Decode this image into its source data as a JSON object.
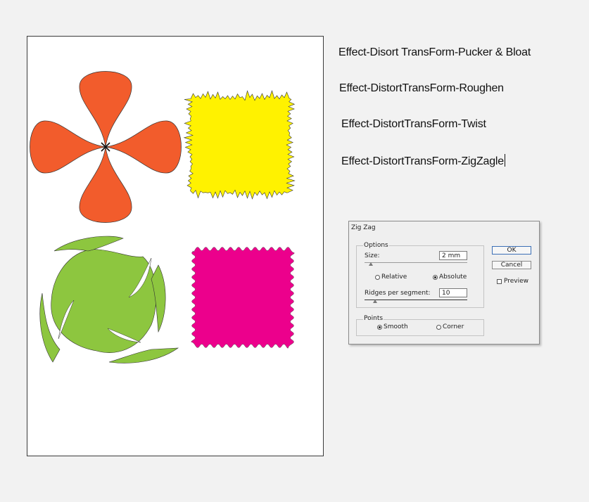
{
  "captions": [
    "Effect-Disort TransForm-Pucker & Bloat",
    "Effect-DistortTransForm-Roughen",
    "Effect-DistortTransForm-Twist",
    "Effect-DistortTransForm-ZigZagle"
  ],
  "shapes": {
    "pucker_color": "#f25c2c",
    "roughen_color": "#fff200",
    "twist_color": "#8dc63f",
    "zigzag_color": "#ec008c"
  },
  "dialog": {
    "title": "Zig Zag",
    "options_label": "Options",
    "size_label": "Size:",
    "size_value": "2 mm",
    "relative_label": "Relative",
    "absolute_label": "Absolute",
    "ridges_label": "Ridges per segment:",
    "ridges_value": "10",
    "points_label": "Points",
    "smooth_label": "Smooth",
    "corner_label": "Corner",
    "ok_label": "OK",
    "cancel_label": "Cancel",
    "preview_label": "Preview",
    "selected_measure": "Absolute",
    "selected_points": "Smooth",
    "preview_checked": false
  }
}
